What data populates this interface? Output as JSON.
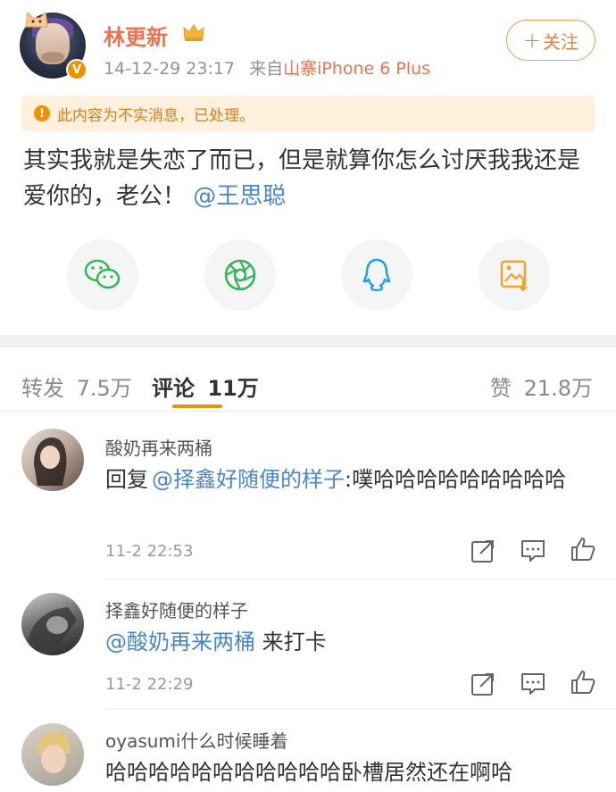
{
  "post": {
    "username": "林更新",
    "timestamp": "14-12-29 23:17",
    "source_prefix": "来自",
    "source": "山寨iPhone 6 Plus",
    "follow_label": "关注",
    "notice": "此内容为不实消息，已处理。",
    "body_text": "其实我就是失恋了而已，但是就算你怎么讨厌我我还是爱你的，老公！",
    "body_mention": "@王思聪"
  },
  "share_icons": [
    "wechat-icon",
    "moments-icon",
    "qq-icon",
    "save-image-icon"
  ],
  "tabs": {
    "repost_label": "转发",
    "repost_count": "7.5万",
    "comment_label": "评论",
    "comment_count": "11万",
    "like_label": "赞",
    "like_count": "21.8万"
  },
  "comments": [
    {
      "name": "酸奶再来两桶",
      "reply_prefix": "回复",
      "mention": "@择鑫好随便的样子",
      "text": ":噗哈哈哈哈哈哈哈哈哈",
      "time": "11-2 22:53"
    },
    {
      "name": "择鑫好随便的样子",
      "mention": "@酸奶再来两桶",
      "text": " 来打卡",
      "time": "11-2 22:29"
    },
    {
      "name": "oyasumi什么时候睡着",
      "text": "哈哈哈哈哈哈哈哈哈哈哈卧槽居然还在啊哈"
    }
  ],
  "colors": {
    "accent": "#f29100",
    "username": "#eb7350",
    "link": "#4a86c8",
    "notice_bg": "#fdf0dc"
  }
}
